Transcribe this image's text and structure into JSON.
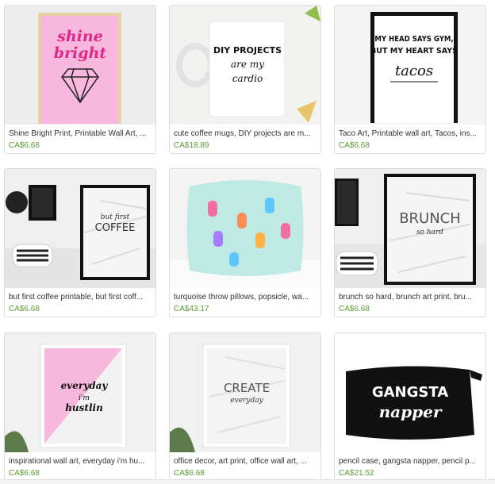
{
  "listings": [
    {
      "title": "Shine Bright Print, Printable Wall Art, ...",
      "price": "CA$6.68",
      "art_text": [
        "shine",
        "bright"
      ]
    },
    {
      "title": "cute coffee mugs, DIY projects are m...",
      "price": "CA$18.89",
      "art_text": [
        "DIY PROJECTS",
        "are my",
        "cardio"
      ]
    },
    {
      "title": "Taco Art, Printable wall art, Tacos, ins...",
      "price": "CA$6.68",
      "art_text": [
        "MY HEAD SAYS GYM,",
        "BUT MY HEART SAYS",
        "tacos"
      ]
    },
    {
      "title": "but first coffee printable, but first coff...",
      "price": "CA$6.68",
      "art_text": [
        "but first",
        "COFFEE"
      ]
    },
    {
      "title": "turquoise throw pillows, popsicle, wa...",
      "price": "CA$43.17",
      "art_text": []
    },
    {
      "title": "brunch so hard, brunch art print, bru...",
      "price": "CA$6.68",
      "art_text": [
        "BRUNCH",
        "so hard"
      ]
    },
    {
      "title": "inspirational wall art, everyday i'm hu...",
      "price": "CA$6.68",
      "art_text": [
        "everyday",
        "i'm",
        "hustlin"
      ]
    },
    {
      "title": "office decor, art print, office wall art, ...",
      "price": "CA$6.68",
      "art_text": [
        "CREATE",
        "everyday"
      ]
    },
    {
      "title": "pencil case, gangsta napper, pencil p...",
      "price": "CA$21.52",
      "art_text": [
        "GANGSTA",
        "napper"
      ]
    }
  ],
  "colors": {
    "price": "#5c9c37",
    "pink": "#f7b6d8",
    "mint": "#bfe9e3"
  }
}
